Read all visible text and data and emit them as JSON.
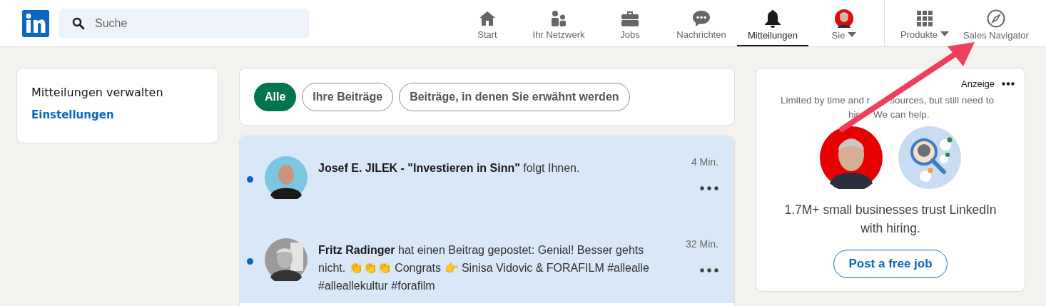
{
  "nav": {
    "search": {
      "placeholder": "Suche"
    },
    "items": [
      {
        "label": "Start",
        "selected": false
      },
      {
        "label": "Ihr Netzwerk",
        "selected": false
      },
      {
        "label": "Jobs",
        "selected": false
      },
      {
        "label": "Nachrichten",
        "selected": false
      },
      {
        "label": "Mitteilungen",
        "selected": true
      },
      {
        "label": "Sie",
        "selected": false,
        "dropdown": true
      }
    ],
    "extra_items": [
      {
        "label": "Produkte",
        "dropdown": true
      },
      {
        "label": "Sales Navigator",
        "dropdown": false
      }
    ]
  },
  "sidebar": {
    "title": "Mitteilungen verwalten",
    "link": "Einstellungen"
  },
  "filters": [
    {
      "label": "Alle",
      "selected": true
    },
    {
      "label": "Ihre Beiträge",
      "selected": false
    },
    {
      "label": "Beiträge, in denen Sie erwähnt werden",
      "selected": false
    }
  ],
  "notifications": [
    {
      "text": "**Josef E. JILEK - \"Investieren in Sinn\"** folgt Ihnen.",
      "time": "4 Min.",
      "unread": true
    },
    {
      "text": "**Fritz Radinger** hat einen Beitrag gepostet: Genial! Besser gehts nicht. 👏👏👏 Congrats 👉 Sinisa Vidovic & FORAFILM #allealle #alleallekultur #forafilm",
      "time": "32 Min.",
      "unread": true
    }
  ],
  "ad": {
    "label": "Anzeige",
    "intro_lines": [
      [
        "Limited by time and r",
        "sources, but still need to"
      ],
      [
        "hir",
        "We can help."
      ]
    ],
    "headline": "1.7M+ small businesses trust LinkedIn with hiring.",
    "button": "Post a free job"
  },
  "annotation": {
    "kind": "arrow"
  }
}
